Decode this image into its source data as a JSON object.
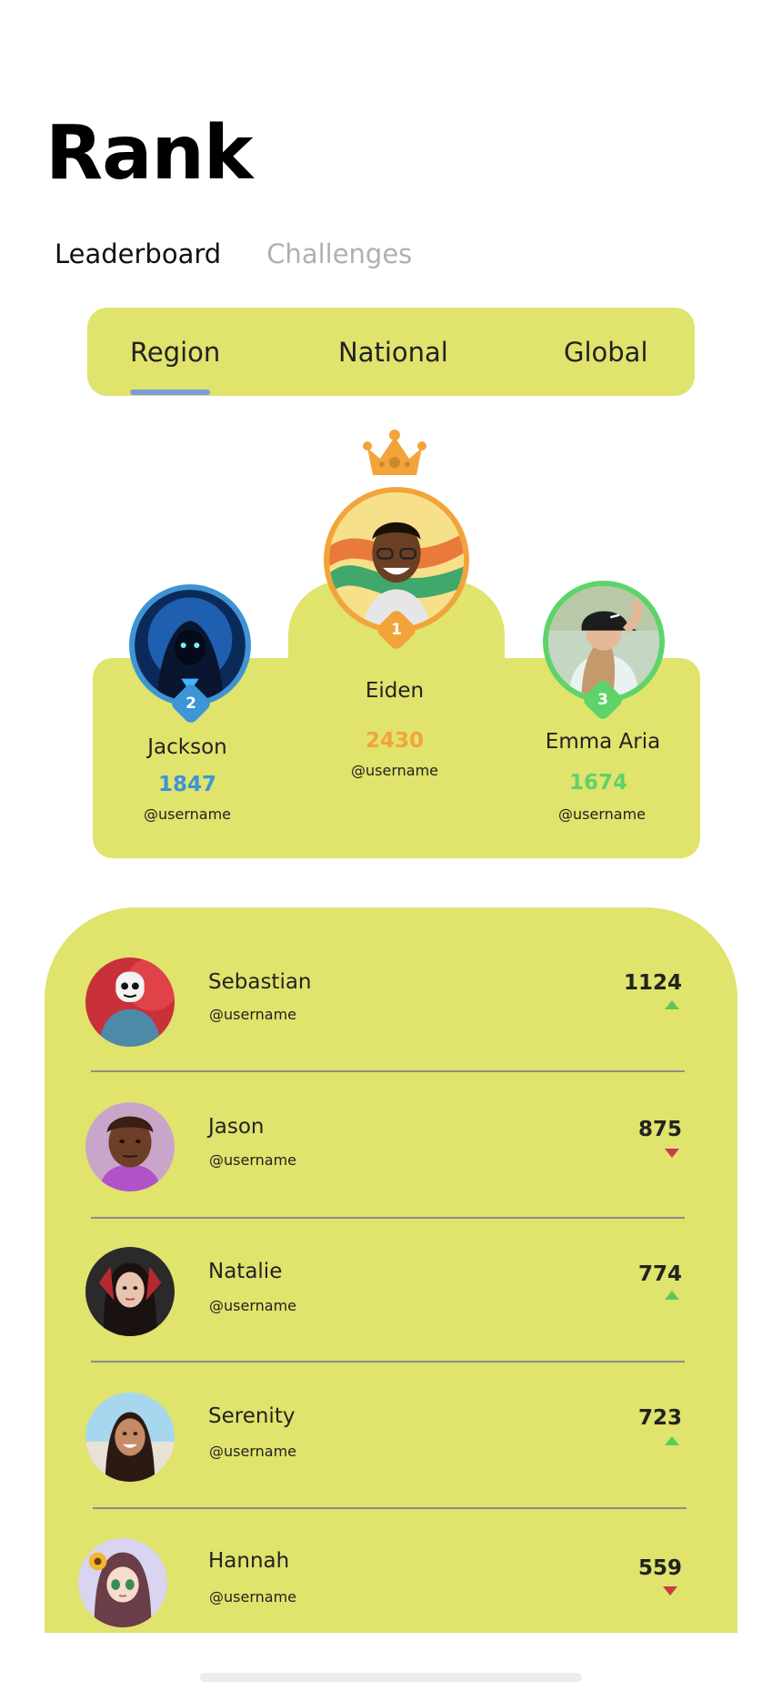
{
  "page": {
    "title": "Rank"
  },
  "top_tabs": [
    {
      "label": "Leaderboard",
      "active": true
    },
    {
      "label": "Challenges",
      "active": false
    }
  ],
  "scope_tabs": [
    {
      "label": "Region",
      "active": true
    },
    {
      "label": "National",
      "active": false
    },
    {
      "label": "Global",
      "active": false
    }
  ],
  "podium": {
    "first": {
      "rank": "1",
      "name": "Eiden",
      "score": "2430",
      "username": "@username",
      "color": "#f2a43a"
    },
    "second": {
      "rank": "2",
      "name": "Jackson",
      "score": "1847",
      "username": "@username",
      "color": "#3d94d6"
    },
    "third": {
      "rank": "3",
      "name": "Emma Aria",
      "score": "1674",
      "username": "@username",
      "color": "#5ed36a"
    }
  },
  "list": [
    {
      "name": "Sebastian",
      "username": "@username",
      "score": "1124",
      "trend": "up"
    },
    {
      "name": "Jason",
      "username": "@username",
      "score": "875",
      "trend": "down"
    },
    {
      "name": "Natalie",
      "username": "@username",
      "score": "774",
      "trend": "up"
    },
    {
      "name": "Serenity",
      "username": "@username",
      "score": "723",
      "trend": "up"
    },
    {
      "name": "Hannah",
      "username": "@username",
      "score": "559",
      "trend": "down"
    }
  ],
  "colors": {
    "panel": "#e0e36c",
    "accent_underline": "#7a9be0",
    "trend_up": "#5cc85c",
    "trend_down": "#c93a4a"
  },
  "icons": {
    "crown": "crown-icon",
    "trend_up": "trend-up-icon",
    "trend_down": "trend-down-icon"
  }
}
